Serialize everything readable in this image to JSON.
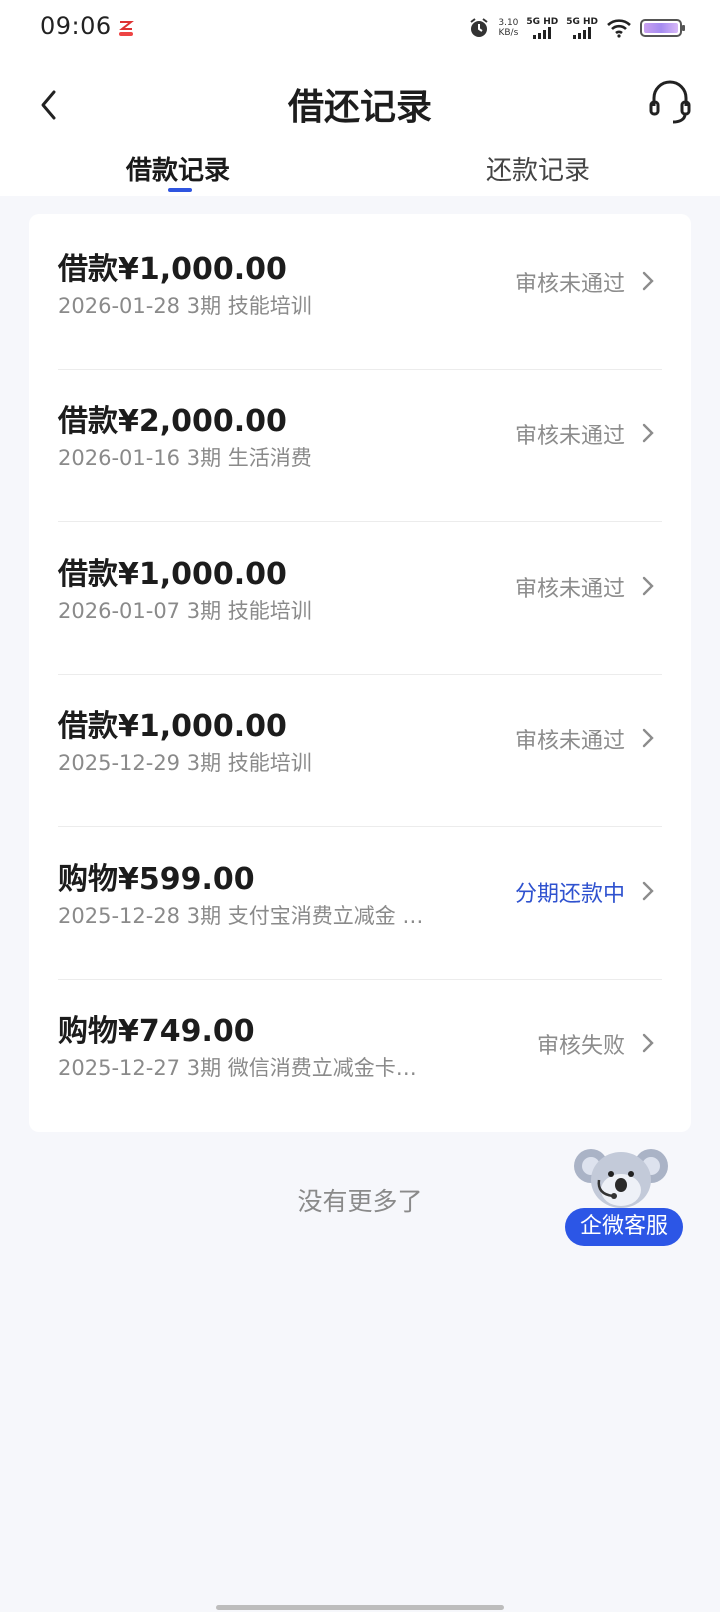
{
  "status_bar": {
    "time": "09:06",
    "speed_value": "3.10",
    "speed_unit": "KB/s",
    "sim1": "5G HD",
    "sim2": "5G HD",
    "icons": [
      "alarm-icon",
      "wifi-icon",
      "battery-icon"
    ]
  },
  "header": {
    "title": "借还记录",
    "tabs": [
      {
        "label": "借款记录",
        "selected": true
      },
      {
        "label": "还款记录",
        "selected": false
      }
    ]
  },
  "records": [
    {
      "amount": "借款¥1,000.00",
      "meta": "2026-01-28 3期  技能培训",
      "status": "审核未通过",
      "status_active": false
    },
    {
      "amount": "借款¥2,000.00",
      "meta": "2026-01-16 3期  生活消费",
      "status": "审核未通过",
      "status_active": false
    },
    {
      "amount": "借款¥1,000.00",
      "meta": "2026-01-07 3期  技能培训",
      "status": "审核未通过",
      "status_active": false
    },
    {
      "amount": "借款¥1,000.00",
      "meta": "2025-12-29 3期  技能培训",
      "status": "审核未通过",
      "status_active": false
    },
    {
      "amount": "购物¥599.00",
      "meta": "2025-12-28 3期  支付宝消费立减金 …",
      "status": "分期还款中",
      "status_active": true
    },
    {
      "amount": "购物¥749.00",
      "meta": "2025-12-27 3期  微信消费立减金卡…",
      "status": "审核失败",
      "status_active": false
    }
  ],
  "footer_text": "没有更多了",
  "float_service_label": "企微客服",
  "colors": {
    "accent": "#2f55e0",
    "active_status": "#2f52cf",
    "muted": "#8c8c8c",
    "background": "#f6f7fb"
  }
}
